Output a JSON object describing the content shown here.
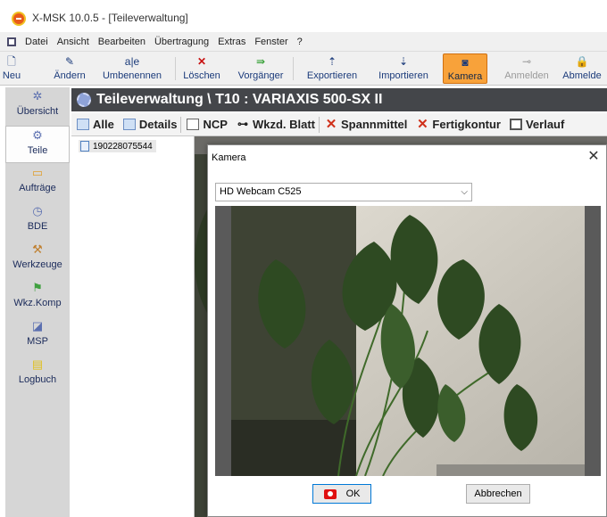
{
  "window": {
    "title": "X-MSK 10.0.5 - [Teileverwaltung]"
  },
  "menu": {
    "items": [
      "Datei",
      "Ansicht",
      "Bearbeiten",
      "Übertragung",
      "Extras",
      "Fenster",
      "?"
    ]
  },
  "toolbar": {
    "items": [
      {
        "label": "Neu",
        "icon": "new-document-icon"
      },
      {
        "label": "Ändern",
        "icon": "edit-icon"
      },
      {
        "label": "Umbenennen",
        "icon": "rename-icon"
      },
      {
        "label": "Löschen",
        "icon": "delete-icon"
      },
      {
        "label": "Vorgänger",
        "icon": "predecessor-icon"
      },
      {
        "label": "Exportieren",
        "icon": "export-icon"
      },
      {
        "label": "Importieren",
        "icon": "import-icon"
      },
      {
        "label": "Kamera",
        "icon": "camera-icon"
      },
      {
        "label": "Anmelden",
        "icon": "login-icon"
      },
      {
        "label": "Abmelde",
        "icon": "logout-icon"
      }
    ]
  },
  "sidebar": {
    "items": [
      {
        "label": "Übersicht",
        "icon": "overview-icon"
      },
      {
        "label": "Teile",
        "icon": "parts-icon"
      },
      {
        "label": "Aufträge",
        "icon": "orders-icon"
      },
      {
        "label": "BDE",
        "icon": "bde-icon"
      },
      {
        "label": "Werkzeuge",
        "icon": "tools-icon"
      },
      {
        "label": "Wkz.Komp",
        "icon": "tool-components-icon"
      },
      {
        "label": "MSP",
        "icon": "msp-icon"
      },
      {
        "label": "Logbuch",
        "icon": "logbook-icon"
      }
    ]
  },
  "header": {
    "title": "Teileverwaltung \\ T10 : VARIAXIS 500-SX II"
  },
  "subtoolbar": {
    "items": [
      {
        "label": "Alle",
        "icon": "grid-icon"
      },
      {
        "label": "Details",
        "icon": "details-icon"
      },
      {
        "label": "NCP",
        "icon": "document-icon"
      },
      {
        "label": "Wkzd. Blatt",
        "icon": "tool-sheet-icon"
      },
      {
        "label": "Spannmittel",
        "icon": "close-red-icon"
      },
      {
        "label": "Fertigkontur",
        "icon": "close-red-icon"
      },
      {
        "label": "Verlauf",
        "icon": "film-icon"
      }
    ]
  },
  "tree": {
    "items": [
      {
        "label": "190228075544"
      }
    ]
  },
  "dialog": {
    "title": "Kamera",
    "camera_select": "HD Webcam C525",
    "ok_label": "OK",
    "cancel_label": "Abbrechen"
  }
}
